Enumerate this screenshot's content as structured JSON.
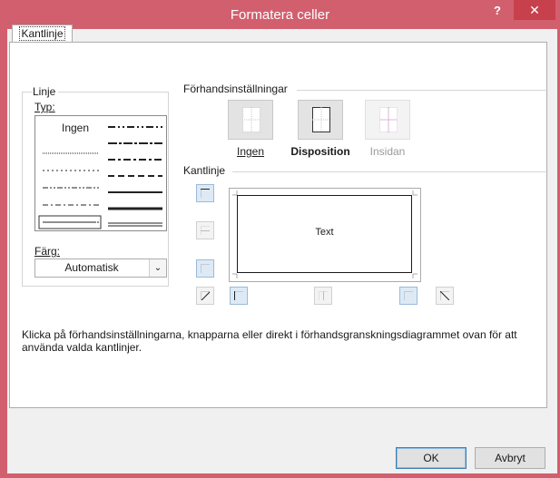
{
  "window": {
    "title": "Formatera celler",
    "help_label": "?",
    "close_label": "✕",
    "accent_color": "#d25f6e"
  },
  "tabs": [
    {
      "label": "Kantlinje",
      "selected": true
    }
  ],
  "linje": {
    "group_label": "Linje",
    "typ_label": "Typ:",
    "none_label": "Ingen",
    "farg_label": "Färg:",
    "color_value": "Automatisk"
  },
  "presets": {
    "group_label": "Förhandsinställningar",
    "items": [
      {
        "label": "Ingen",
        "enabled": true
      },
      {
        "label": "Disposition",
        "enabled": true
      },
      {
        "label": "Insidan",
        "enabled": false
      }
    ]
  },
  "border": {
    "group_label": "Kantlinje",
    "preview_text": "Text"
  },
  "description": "Klicka på förhandsinställningarna, knapparna eller direkt i förhandsgranskningsdiagrammet ovan för att använda valda kantlinjer.",
  "buttons": {
    "ok": "OK",
    "cancel": "Avbryt"
  }
}
